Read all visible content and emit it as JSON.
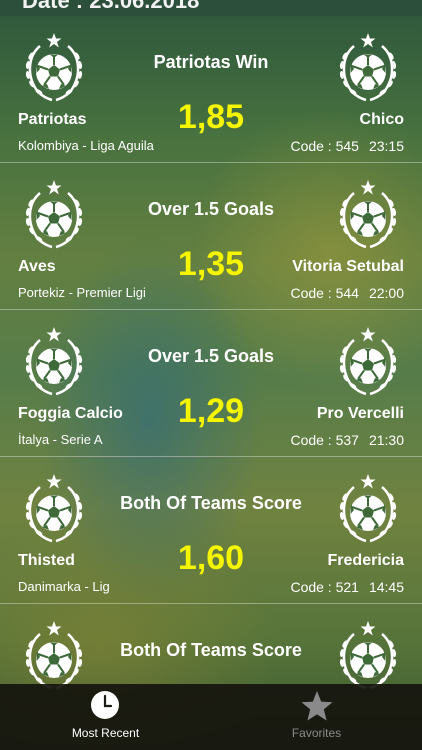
{
  "header": {
    "title": "Date : 23.06.2018"
  },
  "matches": [
    {
      "bet_type": "Patriotas Win",
      "odds": "1,85",
      "home": "Patriotas",
      "away": "Chico",
      "league": "Kolombiya - Liga Aguila",
      "code": "Code : 545",
      "time": "23:15"
    },
    {
      "bet_type": "Over 1.5 Goals",
      "odds": "1,35",
      "home": "Aves",
      "away": "Vitoria Setubal",
      "league": "Portekiz - Premier Ligi",
      "code": "Code : 544",
      "time": "22:00"
    },
    {
      "bet_type": "Over 1.5 Goals",
      "odds": "1,29",
      "home": "Foggia Calcio",
      "away": "Pro Vercelli",
      "league": "İtalya - Serie A",
      "code": "Code : 537",
      "time": "21:30"
    },
    {
      "bet_type": "Both Of Teams Score",
      "odds": "1,60",
      "home": "Thisted",
      "away": "Fredericia",
      "league": "Danimarka - Lig",
      "code": "Code : 521",
      "time": "14:45"
    },
    {
      "bet_type": "Both Of Teams Score",
      "odds": "",
      "home": "",
      "away": "",
      "league": "",
      "code": "",
      "time": ""
    }
  ],
  "tabbar": {
    "recent_label": "Most Recent",
    "favorites_label": "Favorites",
    "recent_icon": "clock-icon",
    "favorites_icon": "star-icon"
  },
  "colors": {
    "odds": "#f5f500",
    "tab_active": "#ffffff",
    "tab_inactive": "#8a8a8a"
  }
}
